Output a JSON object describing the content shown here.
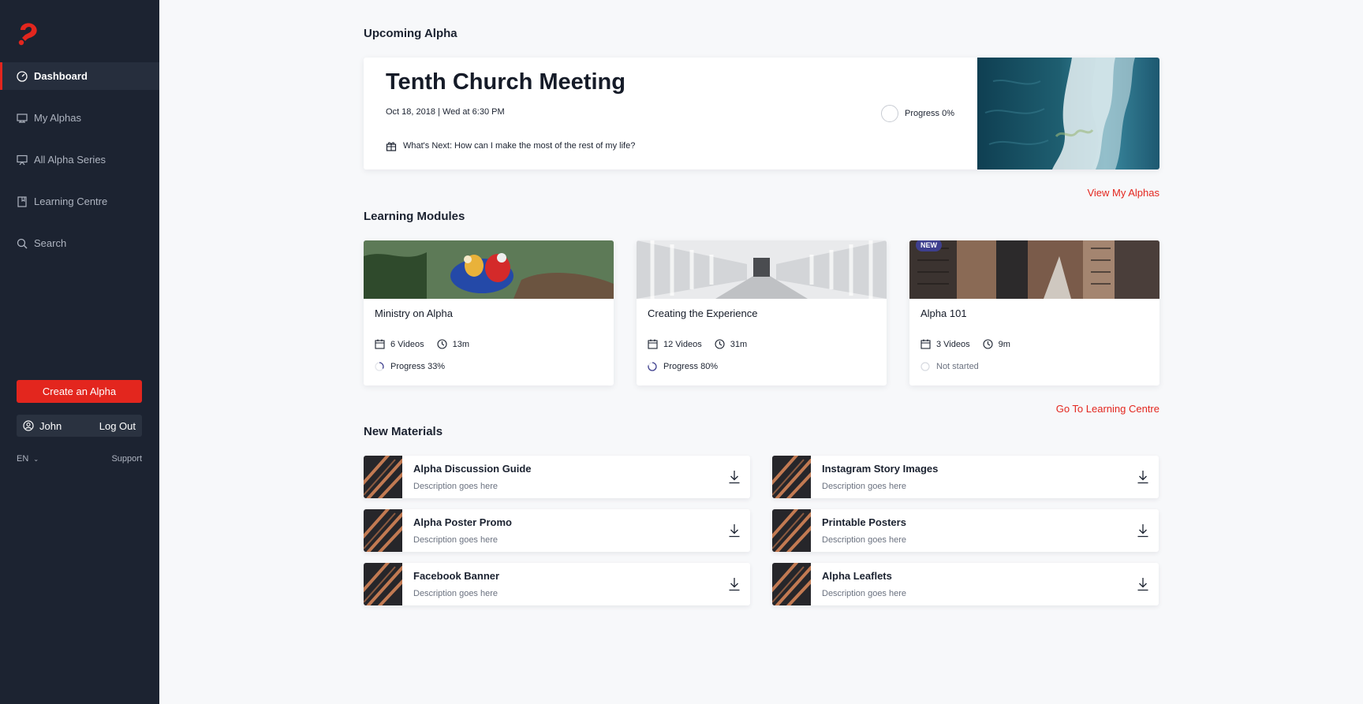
{
  "sidebar": {
    "nav": [
      {
        "label": "Dashboard",
        "icon": "dashboard-icon",
        "active": true
      },
      {
        "label": "My Alphas",
        "icon": "screen-icon"
      },
      {
        "label": "All Alpha Series",
        "icon": "presentation-icon"
      },
      {
        "label": "Learning Centre",
        "icon": "book-icon"
      },
      {
        "label": "Search",
        "icon": "search-icon"
      }
    ],
    "create_label": "Create an Alpha",
    "user_name": "John",
    "logout_label": "Log Out",
    "language": "EN",
    "support_label": "Support"
  },
  "upcoming": {
    "section_title": "Upcoming Alpha",
    "title": "Tenth Church Meeting",
    "date": "Oct 18, 2018 | Wed at 6:30 PM",
    "progress_label": "Progress 0%",
    "next": "What's Next: How can I make the most of the rest of my life?",
    "view_link": "View My Alphas"
  },
  "learning": {
    "section_title": "Learning Modules",
    "link": "Go To Learning Centre",
    "modules": [
      {
        "title": "Ministry on Alpha",
        "videos": "6 Videos",
        "duration": "13m",
        "progress": "Progress 33%",
        "progress_value": 0.33,
        "badge": ""
      },
      {
        "title": "Creating the Experience",
        "videos": "12 Videos",
        "duration": "31m",
        "progress": "Progress 80%",
        "progress_value": 0.8,
        "badge": ""
      },
      {
        "title": "Alpha 101",
        "videos": "3 Videos",
        "duration": "9m",
        "progress": "Not started",
        "progress_value": 0,
        "badge": "NEW"
      }
    ]
  },
  "materials": {
    "section_title": "New Materials",
    "items": [
      {
        "title": "Alpha Discussion Guide",
        "desc": "Description goes here"
      },
      {
        "title": "Instagram Story Images",
        "desc": "Description goes here"
      },
      {
        "title": "Alpha Poster Promo",
        "desc": "Description goes here"
      },
      {
        "title": "Printable Posters",
        "desc": "Description goes here"
      },
      {
        "title": "Facebook Banner",
        "desc": "Description goes here"
      },
      {
        "title": "Alpha Leaflets",
        "desc": "Description goes here"
      }
    ]
  },
  "colors": {
    "accent": "#e3261e",
    "sidebar": "#1c2331",
    "badge": "#3e3f8e"
  }
}
